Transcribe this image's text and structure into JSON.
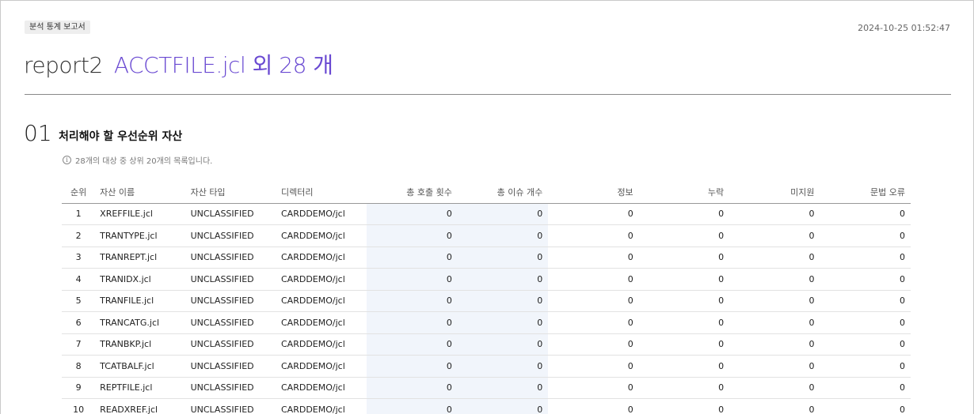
{
  "header": {
    "badge": "분석 통계 보고서",
    "timestamp": "2024-10-25 01:52:47",
    "report_name": "report2",
    "report_files": "ACCTFILE.jcl 외 28 개"
  },
  "section": {
    "number": "01",
    "title": "처리해야 할 우선순위 자산",
    "note": "28개의 대상 중 상위 20개의 목록입니다."
  },
  "table": {
    "columns": [
      "순위",
      "자산 이름",
      "자산 타입",
      "디렉터리",
      "총 호출 횟수",
      "총 이슈 개수",
      "정보",
      "누락",
      "미지원",
      "문법 오류"
    ],
    "rows": [
      {
        "rank": "1",
        "name": "XREFFILE.jcl",
        "type": "UNCLASSIFIED",
        "dir": "CARDDEMO/jcl",
        "calls": "0",
        "issues": "0",
        "info": "0",
        "missing": "0",
        "unsupported": "0",
        "syntax": "0"
      },
      {
        "rank": "2",
        "name": "TRANTYPE.jcl",
        "type": "UNCLASSIFIED",
        "dir": "CARDDEMO/jcl",
        "calls": "0",
        "issues": "0",
        "info": "0",
        "missing": "0",
        "unsupported": "0",
        "syntax": "0"
      },
      {
        "rank": "3",
        "name": "TRANREPT.jcl",
        "type": "UNCLASSIFIED",
        "dir": "CARDDEMO/jcl",
        "calls": "0",
        "issues": "0",
        "info": "0",
        "missing": "0",
        "unsupported": "0",
        "syntax": "0"
      },
      {
        "rank": "4",
        "name": "TRANIDX.jcl",
        "type": "UNCLASSIFIED",
        "dir": "CARDDEMO/jcl",
        "calls": "0",
        "issues": "0",
        "info": "0",
        "missing": "0",
        "unsupported": "0",
        "syntax": "0"
      },
      {
        "rank": "5",
        "name": "TRANFILE.jcl",
        "type": "UNCLASSIFIED",
        "dir": "CARDDEMO/jcl",
        "calls": "0",
        "issues": "0",
        "info": "0",
        "missing": "0",
        "unsupported": "0",
        "syntax": "0"
      },
      {
        "rank": "6",
        "name": "TRANCATG.jcl",
        "type": "UNCLASSIFIED",
        "dir": "CARDDEMO/jcl",
        "calls": "0",
        "issues": "0",
        "info": "0",
        "missing": "0",
        "unsupported": "0",
        "syntax": "0"
      },
      {
        "rank": "7",
        "name": "TRANBKP.jcl",
        "type": "UNCLASSIFIED",
        "dir": "CARDDEMO/jcl",
        "calls": "0",
        "issues": "0",
        "info": "0",
        "missing": "0",
        "unsupported": "0",
        "syntax": "0"
      },
      {
        "rank": "8",
        "name": "TCATBALF.jcl",
        "type": "UNCLASSIFIED",
        "dir": "CARDDEMO/jcl",
        "calls": "0",
        "issues": "0",
        "info": "0",
        "missing": "0",
        "unsupported": "0",
        "syntax": "0"
      },
      {
        "rank": "9",
        "name": "REPTFILE.jcl",
        "type": "UNCLASSIFIED",
        "dir": "CARDDEMO/jcl",
        "calls": "0",
        "issues": "0",
        "info": "0",
        "missing": "0",
        "unsupported": "0",
        "syntax": "0"
      },
      {
        "rank": "10",
        "name": "READXREF.jcl",
        "type": "UNCLASSIFIED",
        "dir": "CARDDEMO/jcl",
        "calls": "0",
        "issues": "0",
        "info": "0",
        "missing": "0",
        "unsupported": "0",
        "syntax": "0"
      }
    ]
  }
}
